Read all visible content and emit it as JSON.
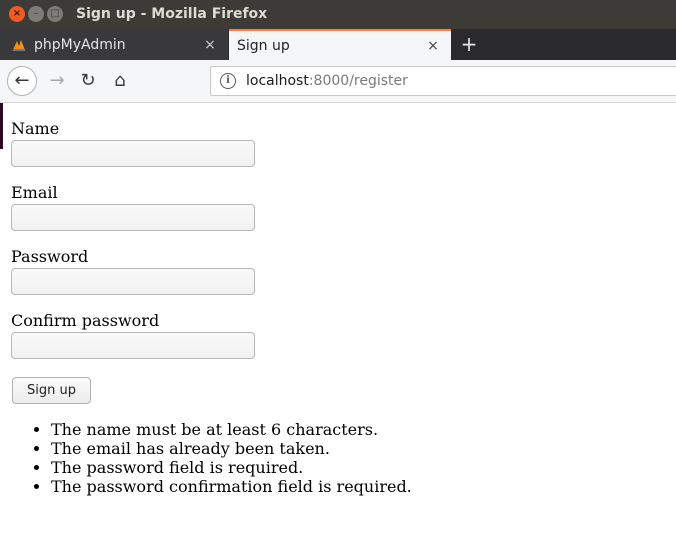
{
  "window": {
    "title": "Sign up - Mozilla Firefox",
    "close_glyph": "×",
    "min_glyph": "–",
    "max_glyph": "□"
  },
  "tabs": [
    {
      "label": "phpMyAdmin",
      "icon": "phpmyadmin-favicon",
      "active": false,
      "close_glyph": "×"
    },
    {
      "label": "Sign up",
      "active": true,
      "close_glyph": "×"
    }
  ],
  "new_tab_glyph": "+",
  "navbar": {
    "back_glyph": "←",
    "forward_glyph": "→",
    "reload_glyph": "↻",
    "home_glyph": "⌂",
    "url_host": "localhost",
    "url_rest": ":8000/register",
    "info_glyph": "i"
  },
  "form": {
    "name_label": "Name",
    "name_value": "",
    "email_label": "Email",
    "email_value": "",
    "password_label": "Password",
    "password_value": "",
    "confirm_label": "Confirm password",
    "confirm_value": "",
    "submit_label": "Sign up"
  },
  "errors": [
    "The name must be at least 6 characters.",
    "The email has already been taken.",
    "The password field is required.",
    "The password confirmation field is required."
  ]
}
